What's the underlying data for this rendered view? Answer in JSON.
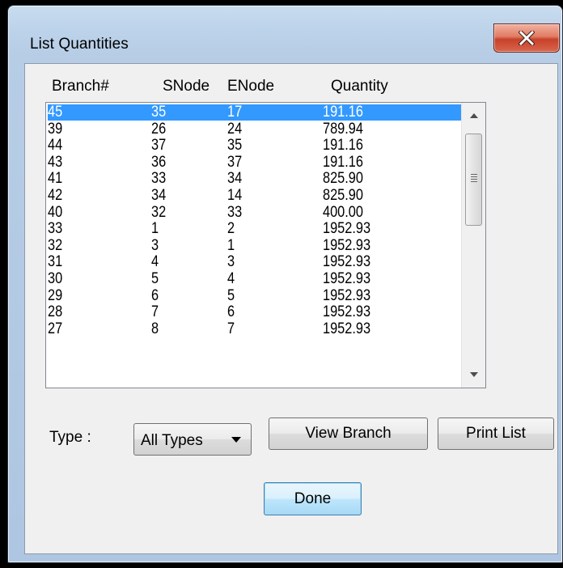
{
  "window": {
    "title": "List Quantities"
  },
  "list": {
    "columns": [
      "Branch#",
      "SNode",
      "ENode",
      "Quantity"
    ],
    "rows": [
      [
        "45",
        "35",
        "17",
        "191.16"
      ],
      [
        "39",
        "26",
        "24",
        "789.94"
      ],
      [
        "44",
        "37",
        "35",
        "191.16"
      ],
      [
        "43",
        "36",
        "37",
        "191.16"
      ],
      [
        "41",
        "33",
        "34",
        "825.90"
      ],
      [
        "42",
        "34",
        "14",
        "825.90"
      ],
      [
        "40",
        "32",
        "33",
        "400.00"
      ],
      [
        "33",
        "1",
        "2",
        "1952.93"
      ],
      [
        "32",
        "3",
        "1",
        "1952.93"
      ],
      [
        "31",
        "4",
        "3",
        "1952.93"
      ],
      [
        "30",
        "5",
        "4",
        "1952.93"
      ],
      [
        "29",
        "6",
        "5",
        "1952.93"
      ],
      [
        "28",
        "7",
        "6",
        "1952.93"
      ],
      [
        "27",
        "8",
        "7",
        "1952.93"
      ]
    ],
    "selected_index": 0
  },
  "controls": {
    "type_label": "Type :",
    "type_value": "All Types",
    "view_branch_label": "View Branch",
    "print_list_label": "Print List",
    "done_label": "Done"
  },
  "colors": {
    "selection": "#3399ff",
    "close_button": "#c7412a",
    "default_button": "#bee6fd"
  },
  "icons": {
    "close": "close-x-icon",
    "scroll_up": "scroll-up-arrow-icon",
    "scroll_down": "scroll-down-arrow-icon",
    "combo_dropdown": "dropdown-arrow-icon"
  }
}
